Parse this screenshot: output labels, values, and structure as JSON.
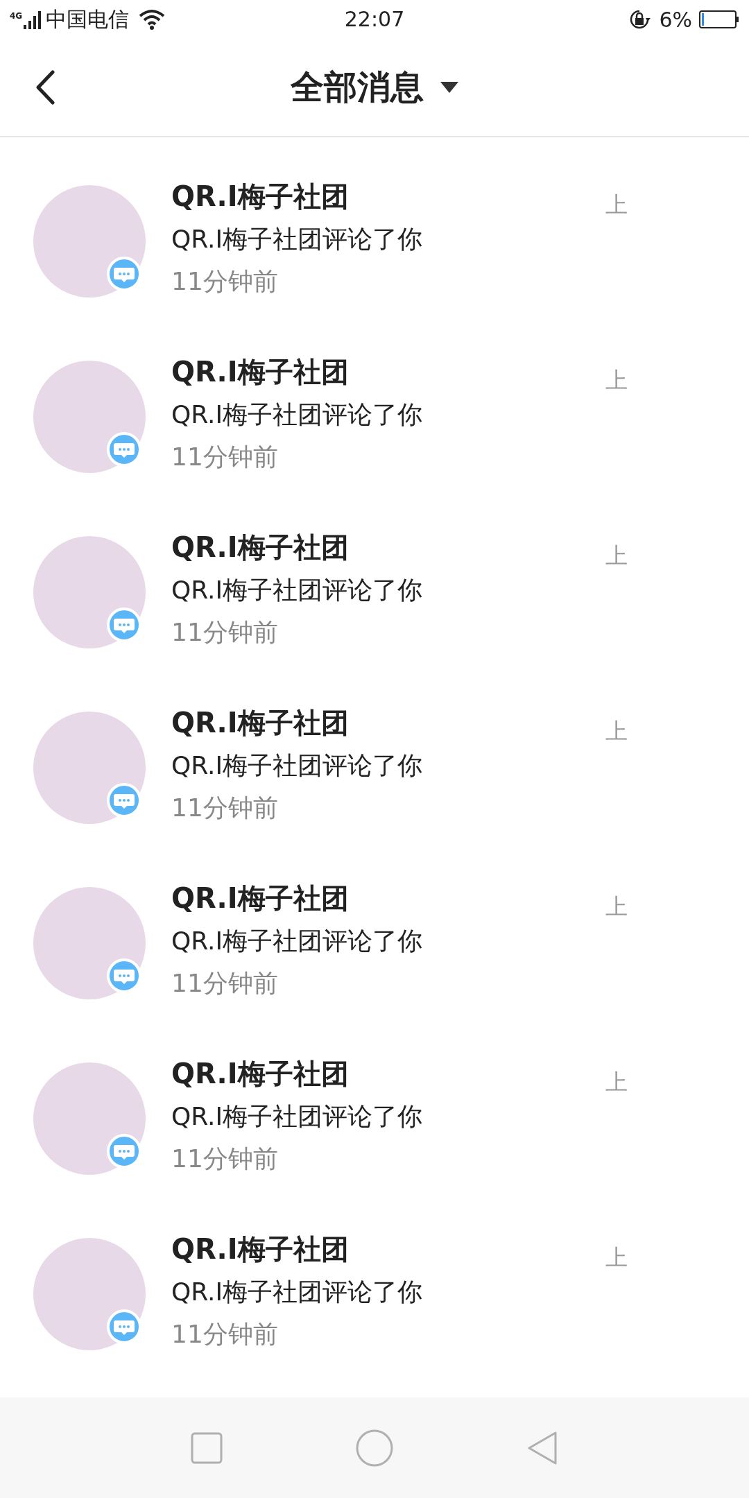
{
  "status_bar": {
    "network": "4G",
    "carrier": "中国电信",
    "time": "22:07",
    "battery": "6%"
  },
  "header": {
    "title": "全部消息"
  },
  "messages": [
    {
      "name": "QR.I梅子社团",
      "text": "QR.I梅子社团评论了你",
      "time": "11分钟前",
      "side": "上"
    },
    {
      "name": "QR.I梅子社团",
      "text": "QR.I梅子社团评论了你",
      "time": "11分钟前",
      "side": "上"
    },
    {
      "name": "QR.I梅子社团",
      "text": "QR.I梅子社团评论了你",
      "time": "11分钟前",
      "side": "上"
    },
    {
      "name": "QR.I梅子社团",
      "text": "QR.I梅子社团评论了你",
      "time": "11分钟前",
      "side": "上"
    },
    {
      "name": "QR.I梅子社团",
      "text": "QR.I梅子社团评论了你",
      "time": "11分钟前",
      "side": "上"
    },
    {
      "name": "QR.I梅子社团",
      "text": "QR.I梅子社团评论了你",
      "time": "11分钟前",
      "side": "上"
    },
    {
      "name": "QR.I梅子社团",
      "text": "QR.I梅子社团评论了你",
      "time": "11分钟前",
      "side": "上"
    }
  ]
}
